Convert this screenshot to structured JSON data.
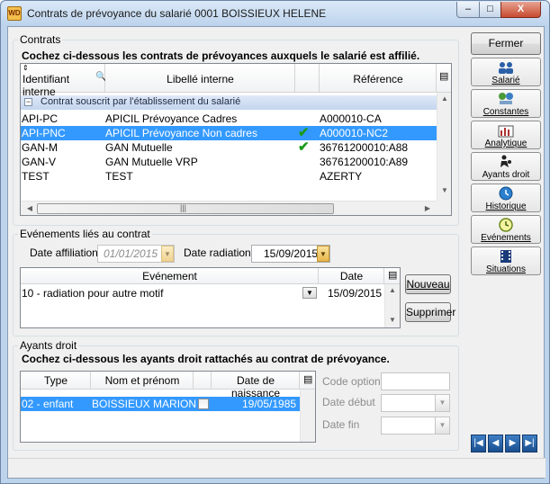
{
  "window": {
    "title": "Contrats de prévoyance du salarié 0001 BOISSIEUX HELENE",
    "app_icon": "WD",
    "close_symbol": "X"
  },
  "contrats": {
    "group_label": "Contrats",
    "instruction": "Cochez ci-dessous les contrats de prévoyances auxquels le salarié est affilié.",
    "columns": [
      "Identifiant interne",
      "Libellé interne",
      "Référence"
    ],
    "group_row": "Contrat souscrit par l'établissement du salarié",
    "rows": [
      {
        "id": "API-PC",
        "libelle": "APICIL Prévoyance Cadres",
        "checked": "",
        "ref": "A000010-CA"
      },
      {
        "id": "API-PNC",
        "libelle": "APICIL Prévoyance Non cadres",
        "checked": "✔",
        "ref": "A000010-NC2"
      },
      {
        "id": "GAN-M",
        "libelle": "GAN Mutuelle",
        "checked": "✔",
        "ref": "36761200010:A88"
      },
      {
        "id": "GAN-V",
        "libelle": "GAN Mutuelle VRP",
        "checked": "",
        "ref": "36761200010:A89"
      },
      {
        "id": "TEST",
        "libelle": "TEST",
        "checked": "",
        "ref": "AZERTY"
      }
    ],
    "selected_row_index": 1
  },
  "evenements": {
    "group_label": "Evénements liés au contrat",
    "date_affiliation_label": "Date affiliation",
    "date_affiliation_value": "01/01/2015",
    "date_radiation_label": "Date radiation",
    "date_radiation_value": "15/09/2015",
    "columns": [
      "Evénement",
      "Date"
    ],
    "rows": [
      {
        "evenement": "10 - radiation pour autre motif",
        "date": "15/09/2015"
      }
    ],
    "nouveau_label": "Nouveau",
    "supprimer_label": "Supprimer"
  },
  "ayants": {
    "group_label": "Ayants droit",
    "instruction": "Cochez ci-dessous les ayants droit rattachés au contrat de prévoyance.",
    "columns": [
      "Type",
      "Nom et prénom",
      "Date de naissance"
    ],
    "rows": [
      {
        "type": "02 - enfant",
        "nom": "BOISSIEUX MARION",
        "date": "19/05/1985"
      }
    ],
    "code_option_label": "Code option",
    "code_option_value": "",
    "date_debut_label": "Date début",
    "date_debut_value": "",
    "date_fin_label": "Date fin",
    "date_fin_value": ""
  },
  "sidebar": {
    "fermer_label": "Fermer",
    "items": [
      {
        "label": "Salarié",
        "icon": "people-icon"
      },
      {
        "label": "Constantes",
        "icon": "scales-icon"
      },
      {
        "label": "Analytique",
        "icon": "chart-icon"
      },
      {
        "label": "Ayants droit",
        "icon": "family-icon"
      },
      {
        "label": "Historique",
        "icon": "clock-icon"
      },
      {
        "label": "Evénements",
        "icon": "history-icon"
      },
      {
        "label": "Situations",
        "icon": "film-icon"
      }
    ]
  },
  "colors": {
    "selection": "#3399ff",
    "group_header": "#c4d5ee",
    "check_green": "#1c9a1c",
    "date_dropdown": "#e8b74a"
  }
}
